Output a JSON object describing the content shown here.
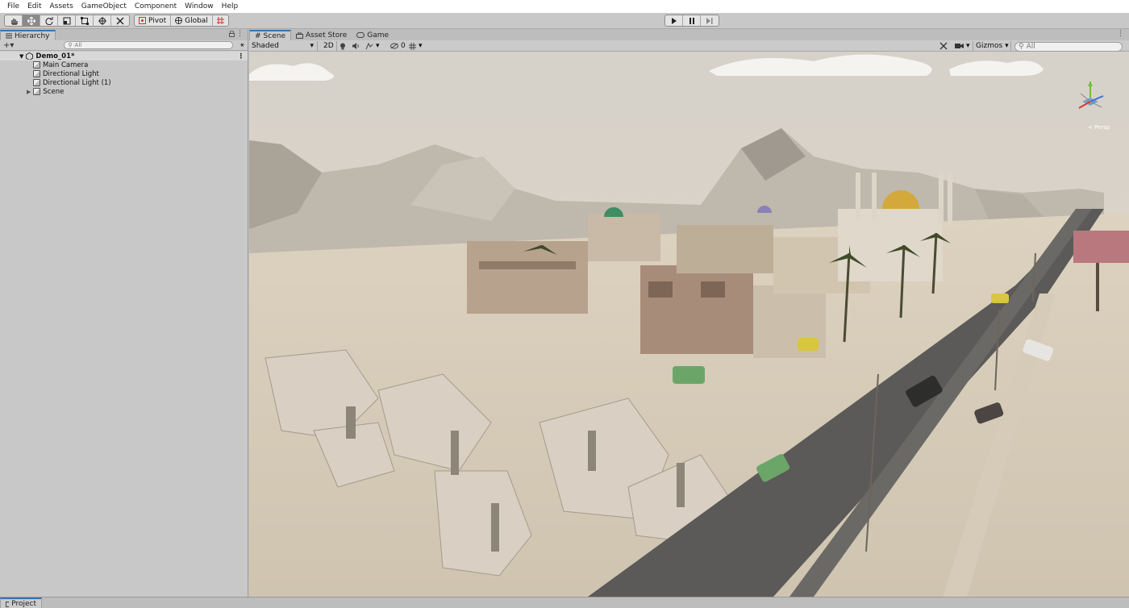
{
  "menu": [
    "File",
    "Edit",
    "Assets",
    "GameObject",
    "Component",
    "Window",
    "Help"
  ],
  "toolbar": {
    "tools": [
      "hand-tool",
      "move-tool",
      "rotate-tool",
      "scale-tool",
      "rect-tool",
      "transform-tool",
      "custom-tool"
    ],
    "pivot_label": "Pivot",
    "global_label": "Global"
  },
  "hierarchy": {
    "tab_label": "Hierarchy",
    "search_placeholder": "All",
    "root": "Demo_01*",
    "items": [
      "Main Camera",
      "Directional Light",
      "Directional Light (1)",
      "Scene"
    ]
  },
  "scene": {
    "tabs": [
      "Scene",
      "Asset Store",
      "Game"
    ],
    "shading": "Shaded",
    "mode_2d": "2D",
    "hidden_count": "0",
    "gizmos_label": "Gizmos",
    "search_placeholder": "All",
    "gizmo_label": "< Persp"
  },
  "project": {
    "tab_label": "Project"
  },
  "colors": {
    "accent": "#3a72b0",
    "sky": "#d8d2c6",
    "sand": "#d6ccb9",
    "road": "#555454"
  }
}
